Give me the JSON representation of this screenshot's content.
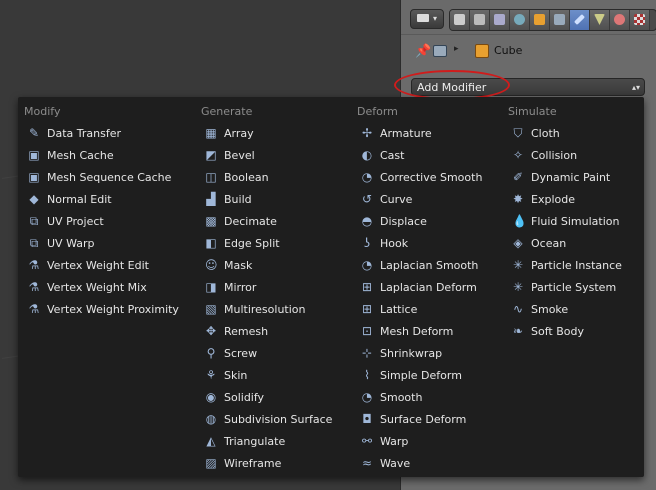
{
  "properties": {
    "object_name": "Cube",
    "add_modifier_label": "Add Modifier"
  },
  "menu": {
    "columns": [
      {
        "header": "Modify",
        "items": [
          {
            "label": "Data Transfer",
            "icon": "data-transfer-icon"
          },
          {
            "label": "Mesh Cache",
            "icon": "mesh-cache-icon"
          },
          {
            "label": "Mesh Sequence Cache",
            "icon": "mesh-sequence-cache-icon"
          },
          {
            "label": "Normal Edit",
            "icon": "normal-edit-icon"
          },
          {
            "label": "UV Project",
            "icon": "uv-project-icon"
          },
          {
            "label": "UV Warp",
            "icon": "uv-warp-icon"
          },
          {
            "label": "Vertex Weight Edit",
            "icon": "vertex-weight-icon"
          },
          {
            "label": "Vertex Weight Mix",
            "icon": "vertex-weight-icon"
          },
          {
            "label": "Vertex Weight Proximity",
            "icon": "vertex-weight-icon"
          }
        ]
      },
      {
        "header": "Generate",
        "items": [
          {
            "label": "Array",
            "icon": "array-icon"
          },
          {
            "label": "Bevel",
            "icon": "bevel-icon"
          },
          {
            "label": "Boolean",
            "icon": "boolean-icon"
          },
          {
            "label": "Build",
            "icon": "build-icon"
          },
          {
            "label": "Decimate",
            "icon": "decimate-icon"
          },
          {
            "label": "Edge Split",
            "icon": "edge-split-icon"
          },
          {
            "label": "Mask",
            "icon": "mask-icon"
          },
          {
            "label": "Mirror",
            "icon": "mirror-icon"
          },
          {
            "label": "Multiresolution",
            "icon": "multiresolution-icon"
          },
          {
            "label": "Remesh",
            "icon": "remesh-icon"
          },
          {
            "label": "Screw",
            "icon": "screw-icon"
          },
          {
            "label": "Skin",
            "icon": "skin-icon"
          },
          {
            "label": "Solidify",
            "icon": "solidify-icon"
          },
          {
            "label": "Subdivision Surface",
            "icon": "subdivision-surface-icon"
          },
          {
            "label": "Triangulate",
            "icon": "triangulate-icon"
          },
          {
            "label": "Wireframe",
            "icon": "wireframe-icon"
          }
        ]
      },
      {
        "header": "Deform",
        "items": [
          {
            "label": "Armature",
            "icon": "armature-icon"
          },
          {
            "label": "Cast",
            "icon": "cast-icon"
          },
          {
            "label": "Corrective Smooth",
            "icon": "smooth-icon"
          },
          {
            "label": "Curve",
            "icon": "curve-icon"
          },
          {
            "label": "Displace",
            "icon": "displace-icon"
          },
          {
            "label": "Hook",
            "icon": "hook-icon"
          },
          {
            "label": "Laplacian Smooth",
            "icon": "smooth-icon"
          },
          {
            "label": "Laplacian Deform",
            "icon": "lattice-icon"
          },
          {
            "label": "Lattice",
            "icon": "lattice-icon"
          },
          {
            "label": "Mesh Deform",
            "icon": "mesh-deform-icon"
          },
          {
            "label": "Shrinkwrap",
            "icon": "shrinkwrap-icon"
          },
          {
            "label": "Simple Deform",
            "icon": "simple-deform-icon"
          },
          {
            "label": "Smooth",
            "icon": "smooth-icon"
          },
          {
            "label": "Surface Deform",
            "icon": "surface-deform-icon"
          },
          {
            "label": "Warp",
            "icon": "warp-icon"
          },
          {
            "label": "Wave",
            "icon": "wave-icon"
          }
        ]
      },
      {
        "header": "Simulate",
        "items": [
          {
            "label": "Cloth",
            "icon": "cloth-icon"
          },
          {
            "label": "Collision",
            "icon": "collision-icon"
          },
          {
            "label": "Dynamic Paint",
            "icon": "dynamic-paint-icon"
          },
          {
            "label": "Explode",
            "icon": "explode-icon"
          },
          {
            "label": "Fluid Simulation",
            "icon": "fluid-icon"
          },
          {
            "label": "Ocean",
            "icon": "ocean-icon"
          },
          {
            "label": "Particle Instance",
            "icon": "particle-icon"
          },
          {
            "label": "Particle System",
            "icon": "particle-icon"
          },
          {
            "label": "Smoke",
            "icon": "smoke-icon"
          },
          {
            "label": "Soft Body",
            "icon": "soft-body-icon"
          }
        ]
      }
    ]
  }
}
